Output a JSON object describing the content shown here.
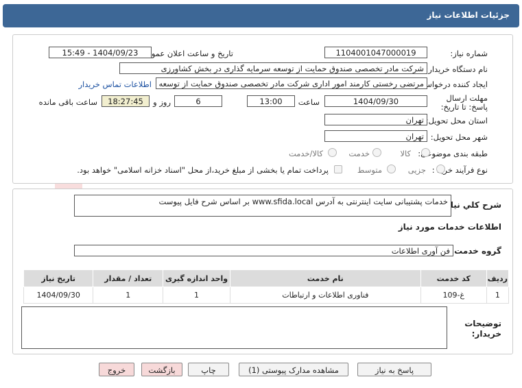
{
  "header": {
    "title": "جزئیات اطلاعات نیاز"
  },
  "form": {
    "need_number_label": "شماره نیاز:",
    "need_number": "1104001047000019",
    "announce_label": "تاریخ و ساعت اعلان عمومی:",
    "announce_value": "1404/09/23 - 15:49",
    "buyer_label": "نام دستگاه خریدار:",
    "buyer_value": "شرکت مادر تخصصی صندوق حمایت از توسعه سرمایه گذاری در بخش کشاورزی",
    "creator_label": "ایجاد کننده درخواست:",
    "creator_value": "مرتضی رخستی کارمند امور اداری شرکت مادر تخصصی صندوق حمایت از توسعه سرمایه",
    "contact_link": "اطلاعات تماس خریدار",
    "deadline_label": "مهلت ارسال پاسخ: تا تاریخ:",
    "deadline_date": "1404/09/30",
    "time_label": "ساعت",
    "deadline_time": "13:00",
    "days_value": "6",
    "days_label": "روز و",
    "remaining_time": "18:27:45",
    "remaining_label": "ساعت باقی مانده",
    "province_label": "استان محل تحویل:",
    "province_value": "تهران",
    "city_label": "شهر محل تحویل:",
    "city_value": "تهران",
    "category_label": "طبقه بندی موضوعی:",
    "category_options": [
      "کالا",
      "خدمت",
      "کالا/خدمت"
    ],
    "process_label": "نوع فرآیند خرید :",
    "process_options": [
      "جزیی",
      "متوسط"
    ],
    "payment_note": "پرداخت تمام یا بخشی از مبلغ خرید،از محل \"اسناد خزانه اسلامی\" خواهد بود."
  },
  "details": {
    "summary_label": "شرح کلي نياز:",
    "summary_value": "خدمات پشتیبانی سایت اینترنتی به آدرس www.sfida.local بر اساس شرح فایل پیوست",
    "services_title": "اطلاعات خدمات مورد نياز",
    "group_label": "گروه خدمت:",
    "group_value": "فن آوری اطلاعات",
    "table_headers": [
      "ردیف",
      "کد خدمت",
      "نام خدمت",
      "واحد اندازه گیری",
      "تعداد / مقدار",
      "تاریخ نیاز"
    ],
    "table_rows": [
      [
        "1",
        "غ-109",
        "فناوری اطلاعات و ارتباطات",
        "1",
        "1",
        "1404/09/30"
      ]
    ],
    "notes_label": "توضیحات خریدار:",
    "notes_value": ""
  },
  "buttons": {
    "reply": "پاسخ به نیاز",
    "attachments": "مشاهده مدارک پیوستی (1)",
    "print": "چاپ",
    "back": "بازگشت",
    "exit": "خروج"
  },
  "watermark": {
    "text": "AriaTender.net"
  },
  "colors": {
    "header": "#3d6796",
    "highlight": "#f2efcf",
    "button_pink": "#f7d9d9",
    "link": "#1a4fa0"
  }
}
